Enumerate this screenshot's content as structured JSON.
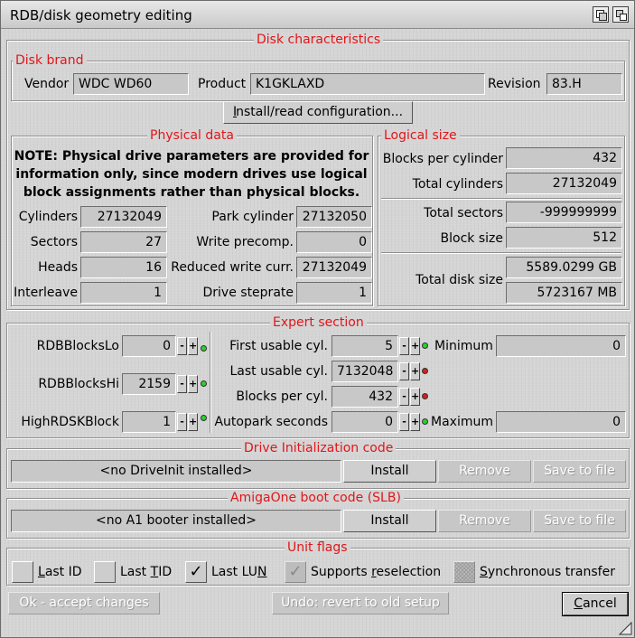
{
  "window": {
    "title": "RDB/disk geometry editing",
    "depth_icon": "depth-gadget-icon",
    "zoom_icon": "zoom-gadget-icon"
  },
  "disk": {
    "group": "Disk characteristics",
    "brand_group": "Disk brand",
    "vendor_label": "Vendor",
    "vendor": "WDC WD60",
    "product_label": "Product",
    "product": "K1GKLAXD",
    "revision_label": "Revision",
    "revision": "83.H",
    "install_button": "Install/read configuration..."
  },
  "physical": {
    "group": "Physical data",
    "note": "NOTE: Physical drive parameters are provided for information only, since modern drives use logical block assignments rather than physical blocks.",
    "cylinders_label": "Cylinders",
    "cylinders": "27132049",
    "sectors_label": "Sectors",
    "sectors": "27",
    "heads_label": "Heads",
    "heads": "16",
    "interleave_label": "Interleave",
    "interleave": "1",
    "park_label": "Park cylinder",
    "park": "27132050",
    "precomp_label": "Write precomp.",
    "precomp": "0",
    "reduced_label": "Reduced write curr.",
    "reduced": "27132049",
    "steprate_label": "Drive steprate",
    "steprate": "1"
  },
  "logical": {
    "group": "Logical size",
    "bpc_label": "Blocks per cylinder",
    "bpc": "432",
    "totcyl_label": "Total cylinders",
    "totcyl": "27132049",
    "totsec_label": "Total sectors",
    "totsec": "-999999999",
    "blocksize_label": "Block size",
    "blocksize": "512",
    "disksize_label": "Total disk size",
    "disksize_gb": "5589.0299 GB",
    "disksize_mb": "5723167 MB"
  },
  "expert": {
    "group": "Expert section",
    "lo_label": "RDBBlocksLo",
    "lo": "0",
    "hi_label": "RDBBlocksHi",
    "hi": "2159",
    "hrdsk_label": "HighRDSKBlock",
    "hrdsk": "1",
    "first_label": "First usable cyl.",
    "first": "5",
    "last_label": "Last usable cyl.",
    "last": "7132048",
    "bpc_label": "Blocks per cyl.",
    "bpc": "432",
    "autopark_label": "Autopark seconds",
    "autopark": "0",
    "min_label": "Minimum",
    "min": "0",
    "max_label": "Maximum",
    "max": "0",
    "minus": "-",
    "plus": "+",
    "led_green": "#2bd12b",
    "led_red": "#d51e1e"
  },
  "driveinit": {
    "group": "Drive Initialization code",
    "status": "<no DriveInit installed>",
    "install": "Install",
    "remove": "Remove",
    "save": "Save to file"
  },
  "amigaone": {
    "group": "AmigaOne boot code (SLB)",
    "status": "<no A1 booter installed>",
    "install": "Install",
    "remove": "Remove",
    "save": "Save to file"
  },
  "unitflags": {
    "group": "Unit flags",
    "last_id_u": "L",
    "last_id_rest": "ast ID",
    "last_tid_pre": "Last ",
    "last_tid_u": "T",
    "last_tid_rest": "ID",
    "last_lun_pre": "Last LU",
    "last_lun_u": "N",
    "check_mark": "✓",
    "resel_pre": "Supports ",
    "resel_u": "r",
    "resel_rest": "eselection",
    "sync_u": "S",
    "sync_rest": "ynchronous transfer"
  },
  "footer": {
    "ok": "Ok - accept changes",
    "undo": "Undo: revert to old setup",
    "cancel_u": "C",
    "cancel_rest": "ancel"
  },
  "colors": {
    "group_label": "#e0161a"
  }
}
